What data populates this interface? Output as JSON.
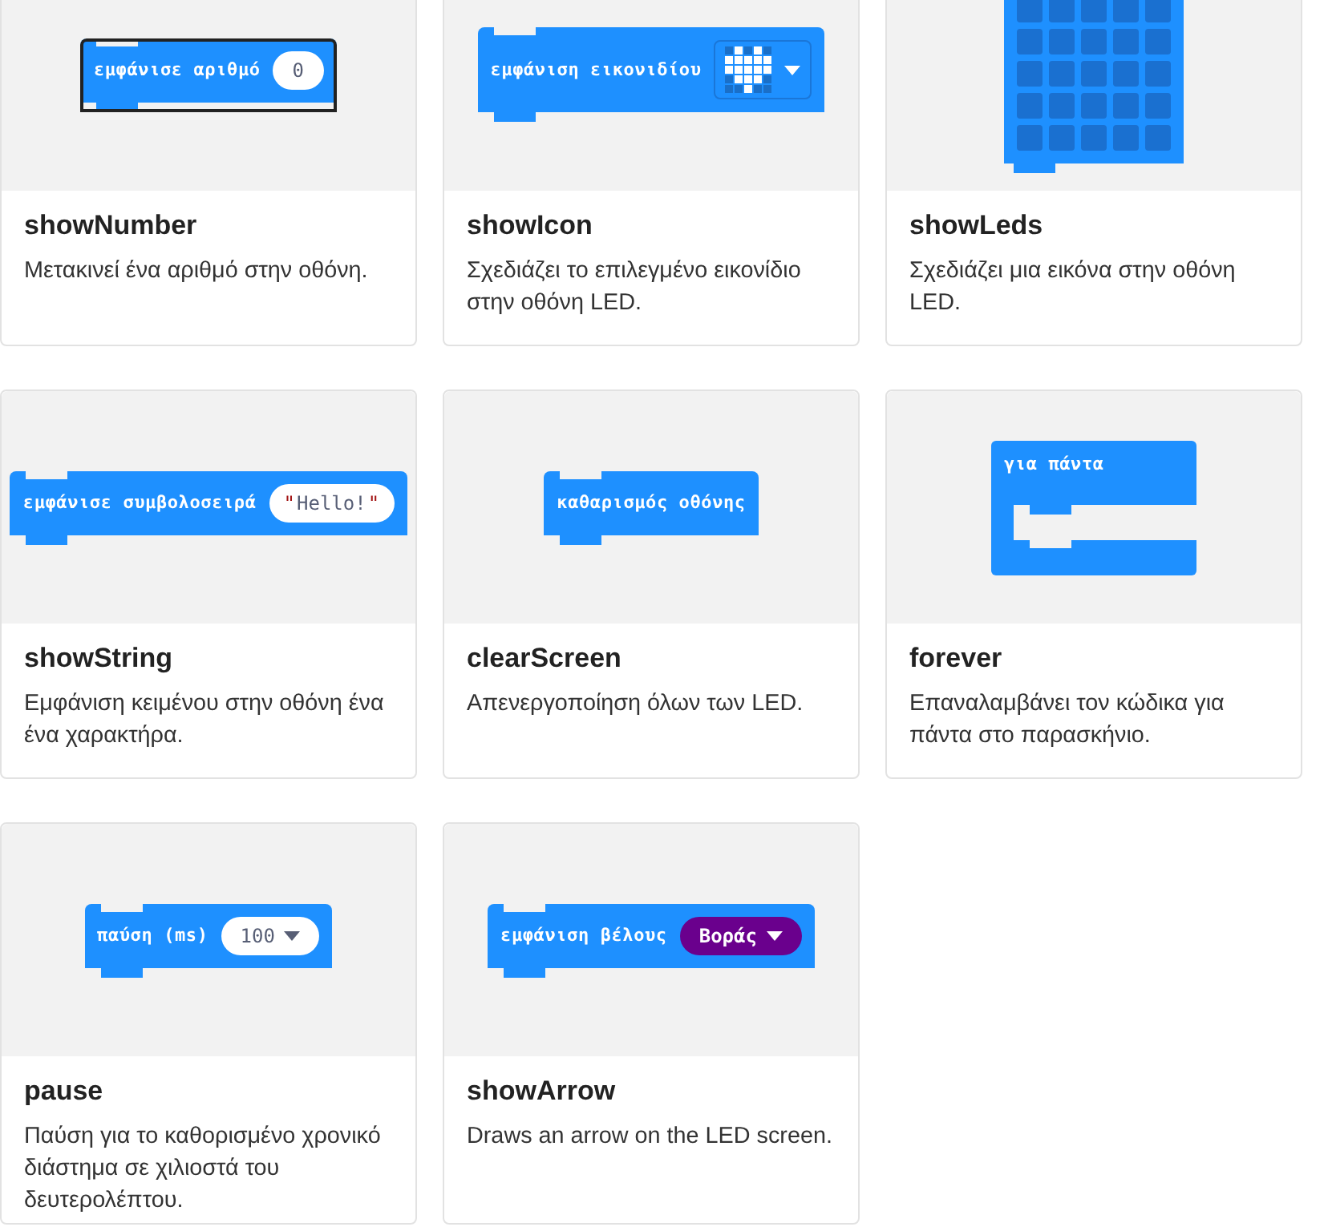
{
  "cards": [
    {
      "title": "showNumber",
      "description": "Μετακινεί ένα αριθμό στην οθόνη.",
      "block": {
        "kind": "number",
        "label": "εμφάνισε αριθμό",
        "value": "0",
        "selected": true
      }
    },
    {
      "title": "showIcon",
      "description": "Σχεδιάζει το επιλεγμένο εικονίδιο στην οθόνη LED.",
      "block": {
        "kind": "icon",
        "label": "εμφάνιση εικονιδίου",
        "selected": false
      }
    },
    {
      "title": "showLeds",
      "description": "Σχεδιάζει μια εικόνα στην οθόνη LED.",
      "block": {
        "kind": "leds",
        "selected": false
      }
    },
    {
      "title": "showString",
      "description": "Εμφάνιση κειμένου στην οθόνη ένα ένα χαρακτήρα.",
      "block": {
        "kind": "string",
        "label": "εμφάνισε συμβολοσειρά",
        "value": "Hello!",
        "quotes": [
          "\"",
          "\""
        ],
        "selected": false
      }
    },
    {
      "title": "clearScreen",
      "description": "Απενεργοποίηση όλων των LED.",
      "block": {
        "kind": "plain",
        "label": "καθαρισμός οθόνης",
        "selected": false
      }
    },
    {
      "title": "forever",
      "description": "Επαναλαμβάνει τον κώδικα για πάντα στο παρασκήνιο.",
      "block": {
        "kind": "loop",
        "label": "για πάντα",
        "selected": false
      }
    },
    {
      "title": "pause",
      "description": "Παύση για το καθορισμένο χρονικό διάστημα σε χιλιοστά του δευτερολέπτου.",
      "block": {
        "kind": "dropdown",
        "label": "παύση (ms)",
        "value": "100",
        "selected": false
      }
    },
    {
      "title": "showArrow",
      "description": "Draws an arrow on the LED screen.",
      "block": {
        "kind": "enum",
        "label": "εμφάνιση βέλους",
        "value": "Βοράς",
        "selected": false
      }
    }
  ]
}
